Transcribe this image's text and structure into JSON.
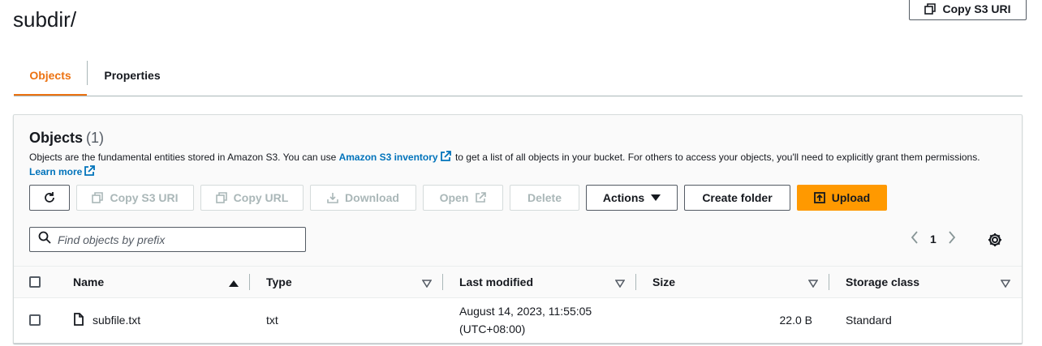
{
  "page": {
    "title": "subdir/"
  },
  "header": {
    "copy_s3_uri": "Copy S3 URI"
  },
  "tabs": [
    {
      "label": "Objects",
      "active": true
    },
    {
      "label": "Properties",
      "active": false
    }
  ],
  "objects": {
    "heading": "Objects",
    "count": "(1)",
    "desc_part1": "Objects are the fundamental entities stored in Amazon S3. You can use ",
    "desc_link1": "Amazon S3 inventory",
    "desc_part2": " to get a list of all objects in your bucket. For others to access your objects, you'll need to explicitly grant them permissions.",
    "learn_more": "Learn more"
  },
  "toolbar": {
    "copy_s3_uri": "Copy S3 URI",
    "copy_url": "Copy URL",
    "download": "Download",
    "open": "Open",
    "delete": "Delete",
    "actions": "Actions",
    "create_folder": "Create folder",
    "upload": "Upload"
  },
  "search": {
    "placeholder": "Find objects by prefix"
  },
  "pagination": {
    "page": "1"
  },
  "table": {
    "columns": [
      "Name",
      "Type",
      "Last modified",
      "Size",
      "Storage class"
    ],
    "rows": [
      {
        "name": "subfile.txt",
        "type": "txt",
        "modified_line1": "August 14, 2023, 11:55:05",
        "modified_line2": "(UTC+08:00)",
        "size": "22.0 B",
        "storage_class": "Standard"
      }
    ]
  },
  "colors": {
    "accent": "#ec7211",
    "link": "#0073bb",
    "primary": "#ff9900",
    "disabled": "#aab7b8"
  }
}
